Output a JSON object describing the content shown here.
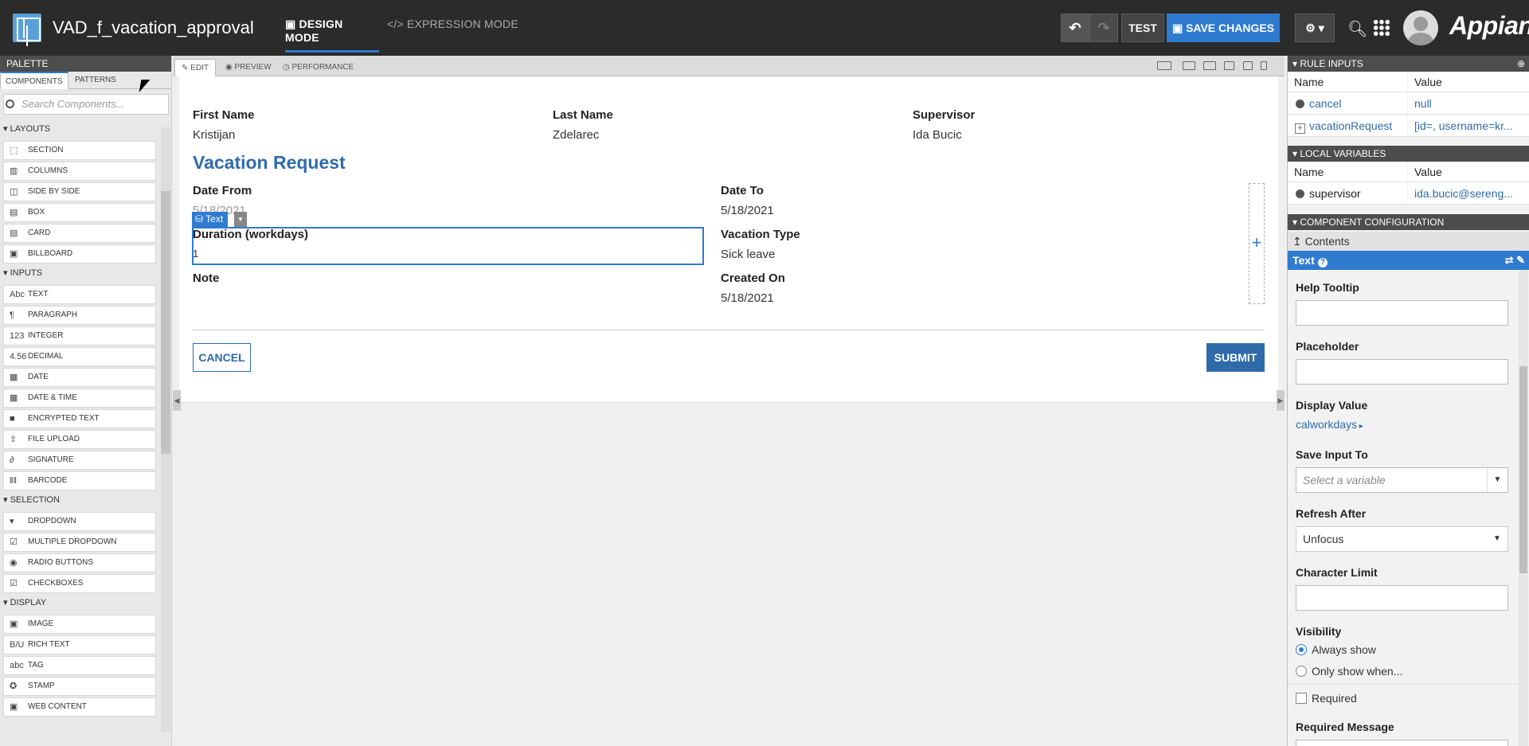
{
  "app": {
    "title": "VAD_f_vacation_approval",
    "brand": "Appian"
  },
  "modes": {
    "design": "DESIGN MODE",
    "expression": "EXPRESSION MODE"
  },
  "toolbar": {
    "undo": "↶",
    "redo": "↷",
    "test": "TEST",
    "save": "SAVE CHANGES",
    "gear": "⚙ ▾"
  },
  "palette": {
    "header": "PALETTE",
    "tabs": [
      "COMPONENTS",
      "PATTERNS"
    ],
    "search_placeholder": "Search Components...",
    "groups": [
      {
        "name": "LAYOUTS",
        "items": [
          {
            "label": "SECTION",
            "icon": "section-icon",
            "glyph": "⬚"
          },
          {
            "label": "COLUMNS",
            "icon": "columns-icon",
            "glyph": "▥"
          },
          {
            "label": "SIDE BY SIDE",
            "icon": "side-by-side-icon",
            "glyph": "◫"
          },
          {
            "label": "BOX",
            "icon": "box-icon",
            "glyph": "▤"
          },
          {
            "label": "CARD",
            "icon": "card-icon",
            "glyph": "▤"
          },
          {
            "label": "BILLBOARD",
            "icon": "billboard-icon",
            "glyph": "▣"
          }
        ]
      },
      {
        "name": "INPUTS",
        "items": [
          {
            "label": "TEXT",
            "icon": "text-icon",
            "glyph": "Abc"
          },
          {
            "label": "PARAGRAPH",
            "icon": "paragraph-icon",
            "glyph": "¶"
          },
          {
            "label": "INTEGER",
            "icon": "integer-icon",
            "glyph": "123"
          },
          {
            "label": "DECIMAL",
            "icon": "decimal-icon",
            "glyph": "4.56"
          },
          {
            "label": "DATE",
            "icon": "calendar-icon",
            "glyph": "▦"
          },
          {
            "label": "DATE & TIME",
            "icon": "date-time-icon",
            "glyph": "▦"
          },
          {
            "label": "ENCRYPTED TEXT",
            "icon": "lock-icon",
            "glyph": "■"
          },
          {
            "label": "FILE UPLOAD",
            "icon": "upload-icon",
            "glyph": "⇪"
          },
          {
            "label": "SIGNATURE",
            "icon": "signature-icon",
            "glyph": "∂"
          },
          {
            "label": "BARCODE",
            "icon": "barcode-icon",
            "glyph": "‖‖"
          }
        ]
      },
      {
        "name": "SELECTION",
        "items": [
          {
            "label": "DROPDOWN",
            "icon": "dropdown-icon",
            "glyph": "▾"
          },
          {
            "label": "MULTIPLE DROPDOWN",
            "icon": "multiple-dropdown-icon",
            "glyph": "☑"
          },
          {
            "label": "RADIO BUTTONS",
            "icon": "radio-icon",
            "glyph": "◉"
          },
          {
            "label": "CHECKBOXES",
            "icon": "checkbox-icon",
            "glyph": "☑"
          }
        ]
      },
      {
        "name": "DISPLAY",
        "items": [
          {
            "label": "IMAGE",
            "icon": "image-icon",
            "glyph": "▣"
          },
          {
            "label": "RICH TEXT",
            "icon": "rich-text-icon",
            "glyph": "B/U"
          },
          {
            "label": "TAG",
            "icon": "tag-icon",
            "glyph": "abc"
          },
          {
            "label": "STAMP",
            "icon": "stamp-icon",
            "glyph": "✪"
          },
          {
            "label": "WEB CONTENT",
            "icon": "web-content-icon",
            "glyph": "▣"
          }
        ]
      }
    ]
  },
  "canvas": {
    "tabs": {
      "edit": "EDIT",
      "preview": "PREVIEW",
      "performance": "PERFORMANCE"
    },
    "form": {
      "first_name_label": "First Name",
      "first_name": "Kristijan",
      "last_name_label": "Last Name",
      "last_name": "Zdelarec",
      "supervisor_label": "Supervisor",
      "supervisor": "Ida Bucic",
      "title": "Vacation Request",
      "date_from_label": "Date From",
      "date_from": "5/18/2021",
      "date_to_label": "Date To",
      "date_to": "5/18/2021",
      "duration_label": "Duration (workdays)",
      "duration": "1",
      "vacation_type_label": "Vacation Type",
      "vacation_type": "Sick leave",
      "note_label": "Note",
      "created_on_label": "Created On",
      "created_on": "5/18/2021",
      "selection_tag": "Text",
      "cancel": "CANCEL",
      "submit": "SUBMIT"
    }
  },
  "rule_inputs": {
    "header": "RULE INPUTS",
    "col_name": "Name",
    "col_value": "Value",
    "rows": [
      {
        "name": "cancel",
        "value": "null"
      },
      {
        "name": "vacationRequest",
        "value": "[id=, username=kr..."
      }
    ]
  },
  "local_variables": {
    "header": "LOCAL VARIABLES",
    "col_name": "Name",
    "col_value": "Value",
    "rows": [
      {
        "name": "supervisor",
        "value": "ida.bucic@sereng..."
      }
    ]
  },
  "component_config": {
    "header": "COMPONENT CONFIGURATION",
    "contents_link": "Contents",
    "component": "Text",
    "help_tooltip_label": "Help Tooltip",
    "help_tooltip": "",
    "placeholder_label": "Placeholder",
    "placeholder": "",
    "display_value_label": "Display Value",
    "display_value": "calworkdays",
    "save_input_label": "Save Input To",
    "save_input_placeholder": "Select a variable",
    "refresh_after_label": "Refresh After",
    "refresh_after": "Unfocus",
    "char_limit_label": "Character Limit",
    "char_limit": "",
    "visibility_label": "Visibility",
    "visibility_options": [
      "Always show",
      "Only show when..."
    ],
    "visibility_selected": "Always show",
    "required_label": "Required",
    "required_message_label": "Required Message"
  },
  "colors": {
    "accent": "#2f7bd0",
    "topbar": "#2b2b2b",
    "form_title": "#2f6bab"
  }
}
